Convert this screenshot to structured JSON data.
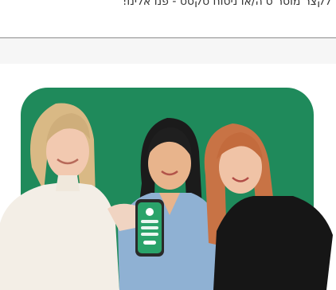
{
  "banner": {
    "text": "לקצר מוסר ס'ה/או ניסוח טקסט - פנו אלינו!"
  },
  "colors": {
    "brand_green": "#1f8a5b",
    "divider": "#8c8c8c"
  },
  "hero": {
    "icon": "team-photo-with-app"
  }
}
